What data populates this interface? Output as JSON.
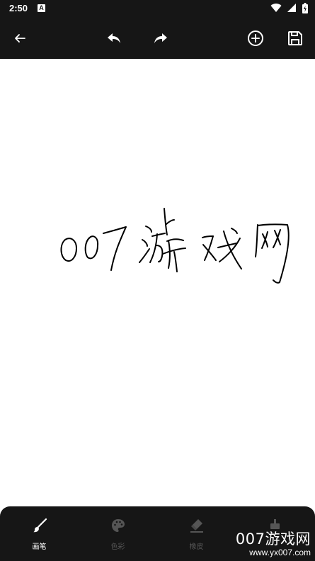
{
  "status_bar": {
    "time": "2:50",
    "notification_icon": "A"
  },
  "toolbar": {
    "icons": [
      "back-arrow-icon",
      "undo-icon",
      "redo-icon",
      "add-circle-icon",
      "save-icon"
    ]
  },
  "canvas": {
    "handwriting_strokes_color": "#000000"
  },
  "bottom_nav": {
    "items": [
      {
        "label": "画笔",
        "icon": "brush-icon",
        "active": true
      },
      {
        "label": "色彩",
        "icon": "palette-icon",
        "active": false
      },
      {
        "label": "橡皮",
        "icon": "eraser-icon",
        "active": false
      },
      {
        "label": "",
        "icon": "bucket-icon",
        "active": false
      }
    ]
  },
  "watermark": {
    "title": "007游戏网",
    "url": "www.yx007.com"
  },
  "colors": {
    "bar_background": "#161616",
    "canvas_background": "#ffffff",
    "inactive_icon": "#555555"
  }
}
